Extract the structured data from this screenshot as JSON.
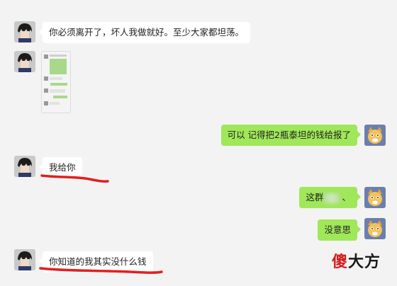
{
  "messages": [
    {
      "id": "m1",
      "side": "left",
      "text": "你必须离开了，坏人我做就好。至少大家都坦荡。"
    },
    {
      "id": "m2",
      "side": "left",
      "type": "image",
      "description": "chat screenshot thumbnail"
    },
    {
      "id": "m3",
      "side": "right",
      "text": "可以 记得把2瓶泰坦的钱给报了"
    },
    {
      "id": "m4",
      "side": "left",
      "text": "我给你"
    },
    {
      "id": "m5",
      "side": "right",
      "text_before": "这群",
      "text_after": "、"
    },
    {
      "id": "m6",
      "side": "right",
      "text": "没意思"
    },
    {
      "id": "m7",
      "side": "left",
      "text": "你知道的我其实没什么钱"
    }
  ],
  "watermark": {
    "first": "傻",
    "rest": "大方"
  },
  "colors": {
    "background": "#f3f3f3",
    "left_bubble": "#ffffff",
    "right_bubble": "#a0e75a",
    "underline": "#e02020"
  }
}
